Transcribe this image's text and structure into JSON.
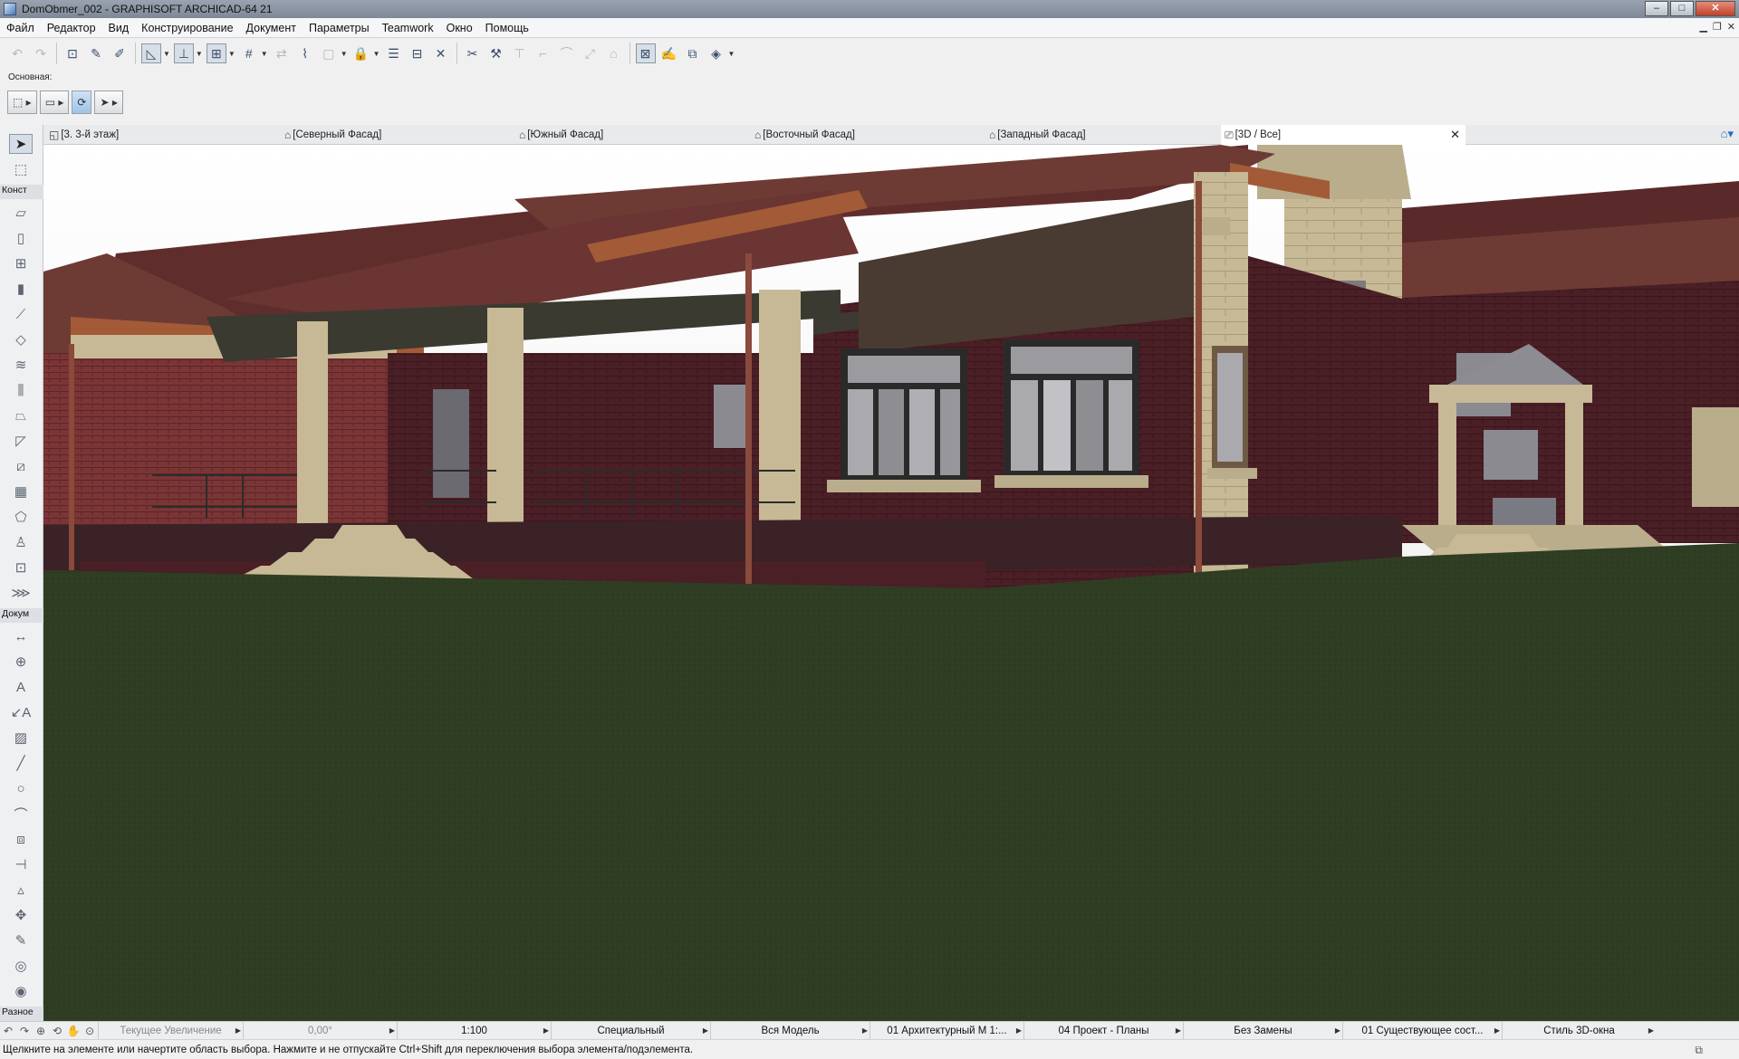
{
  "window": {
    "title": "DomObmer_002 - GRAPHISOFT ARCHICAD-64 21"
  },
  "menu": [
    "Файл",
    "Редактор",
    "Вид",
    "Конструирование",
    "Документ",
    "Параметры",
    "Teamwork",
    "Окно",
    "Помощь"
  ],
  "infobox": {
    "label": "Основная:"
  },
  "tabs": [
    {
      "label": "[3. 3-й этаж]",
      "icon": "floor-plan-icon"
    },
    {
      "label": "[Северный Фасад]",
      "icon": "elevation-icon"
    },
    {
      "label": "[Южный Фасад]",
      "icon": "elevation-icon"
    },
    {
      "label": "[Восточный Фасад]",
      "icon": "elevation-icon"
    },
    {
      "label": "[Западный Фасад]",
      "icon": "elevation-icon"
    },
    {
      "label": "[3D / Все]",
      "icon": "camera-3d-icon",
      "active": true
    }
  ],
  "toolbox": {
    "sections": [
      "Конст",
      "Докум",
      "Разное"
    ]
  },
  "quick_options": {
    "zoom_label": "Текущее Увеличение",
    "angle": "0,00°",
    "scale": "1:100",
    "layer_combo": "Специальный",
    "model_view": "Вся Модель",
    "pen_set": "01 Архитектурный М 1:...",
    "mvo": "04 Проект - Планы",
    "override": "Без Замены",
    "renovation": "01 Существующее сост...",
    "window_style": "Стиль 3D-окна"
  },
  "status": {
    "message": "Щелкните на элементе или начертите область выбора. Нажмите и не отпускайте Ctrl+Shift для переключения выбора элемента/подэлемента."
  },
  "colors": {
    "lawn": "#2f3d22",
    "roof": "#6e3b34",
    "brick": "#4a1f26",
    "stone": "#c7b995",
    "sky": "#ffffff"
  }
}
